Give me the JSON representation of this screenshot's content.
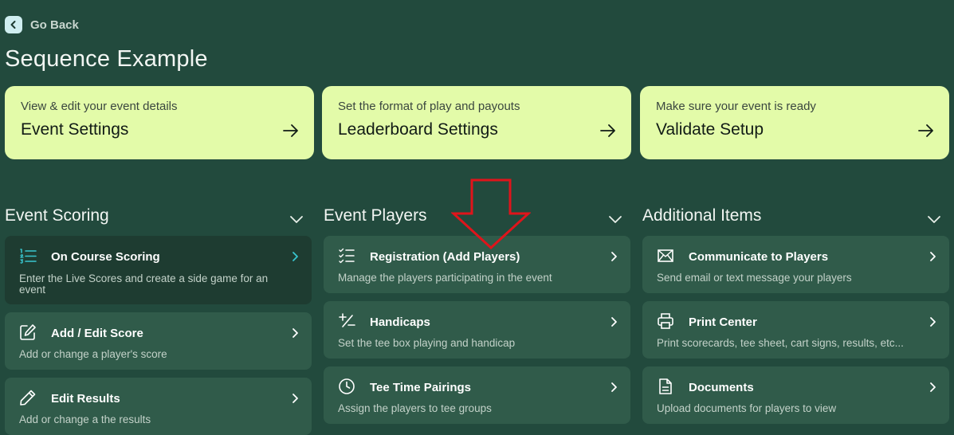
{
  "nav": {
    "back_label": "Go Back"
  },
  "page": {
    "title": "Sequence Example"
  },
  "setup_cards": [
    {
      "subtitle": "View & edit your event details",
      "title": "Event Settings"
    },
    {
      "subtitle": "Set the format of play and payouts",
      "title": "Leaderboard Settings"
    },
    {
      "subtitle": "Make sure your event is ready",
      "title": "Validate Setup"
    }
  ],
  "sections": [
    {
      "title": "Event Scoring",
      "items": [
        {
          "title": "On Course Scoring",
          "description": "Enter the Live Scores and create a side game for an event",
          "icon": "numbered-list-icon"
        },
        {
          "title": "Add / Edit Score",
          "description": "Add or change a player's score",
          "icon": "edit-square-icon"
        },
        {
          "title": "Edit Results",
          "description": "Add or change a the results",
          "icon": "pencil-icon"
        }
      ]
    },
    {
      "title": "Event Players",
      "items": [
        {
          "title": "Registration (Add Players)",
          "description": "Manage the players participating in the event",
          "icon": "checklist-icon"
        },
        {
          "title": "Handicaps",
          "description": "Set the tee box playing and handicap",
          "icon": "plus-minus-icon"
        },
        {
          "title": "Tee Time Pairings",
          "description": "Assign the players to tee groups",
          "icon": "clock-icon"
        }
      ]
    },
    {
      "title": "Additional Items",
      "items": [
        {
          "title": "Communicate to Players",
          "description": "Send email or text message your players",
          "icon": "envelope-icon"
        },
        {
          "title": "Print Center",
          "description": "Print scorecards, tee sheet, cart signs, results, etc...",
          "icon": "printer-icon"
        },
        {
          "title": "Documents",
          "description": "Upload documents for players to view",
          "icon": "document-icon"
        }
      ]
    }
  ],
  "colors": {
    "background": "#224a3d",
    "card": "#305b4a",
    "card_active": "#1e3c31",
    "accent_lime": "#e3fba9",
    "active_chevron": "#38c6cf",
    "annotation_arrow": "#e0141b"
  }
}
